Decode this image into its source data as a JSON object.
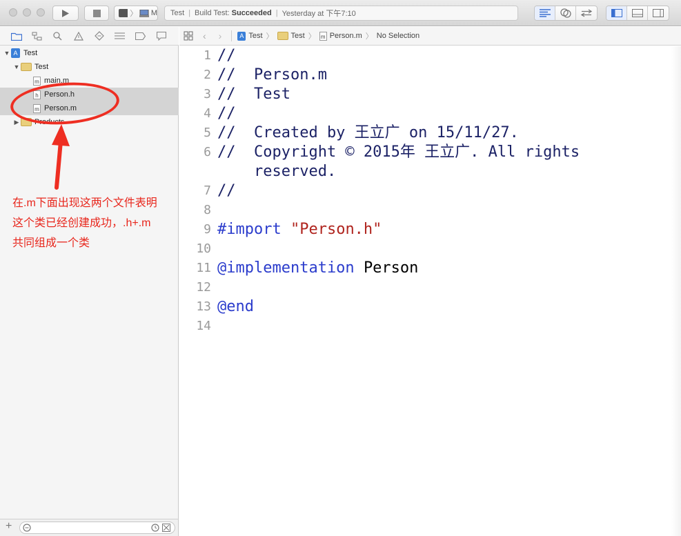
{
  "toolbar": {
    "scheme_text": "M",
    "status": {
      "project": "Test",
      "build_label": "Build Test:",
      "build_result": "Succeeded",
      "timestamp": "Yesterday at 下午7:10"
    }
  },
  "navigator": {
    "items": [
      {
        "label": "Test",
        "type": "project"
      },
      {
        "label": "Test",
        "type": "folder"
      },
      {
        "label": "main.m",
        "type": "file",
        "badge": "m"
      },
      {
        "label": "Person.h",
        "type": "file",
        "badge": "h"
      },
      {
        "label": "Person.m",
        "type": "file",
        "badge": "m"
      },
      {
        "label": "Products",
        "type": "folder"
      }
    ]
  },
  "jumpbar": {
    "crumbs": [
      "Test",
      "Test",
      "Person.m",
      "No Selection"
    ],
    "file_badge": "m"
  },
  "editor": {
    "line_numbers": [
      "1",
      "2",
      "3",
      "4",
      "5",
      "6",
      "7",
      "8",
      "9",
      "10",
      "11",
      "12",
      "13",
      "14"
    ],
    "lines": {
      "l1": "//",
      "l2": "//  Person.m",
      "l3": "//  Test",
      "l4": "//",
      "l5": "//  Created by 王立广 on 15/11/27.",
      "l6a": "//  Copyright © 2015年 王立广. All rights",
      "l6b": "    reserved.",
      "l7": "//",
      "l9_kw": "#import",
      "l9_str": "\"Person.h\"",
      "l11_kw": "@implementation",
      "l11_name": "Person",
      "l13_kw": "@end"
    }
  },
  "annotation": {
    "lines": [
      "在.m下面出现这两个文件表明",
      "这个类已经创建成功，.h+.m",
      "共同组成一个类"
    ],
    "color": "#e8261c"
  }
}
